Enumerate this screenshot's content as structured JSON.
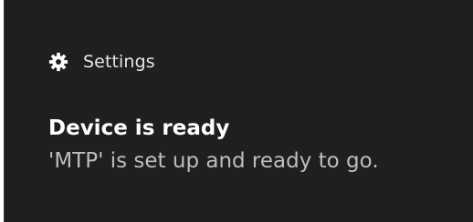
{
  "notification": {
    "app_name": "Settings",
    "app_icon": "gear-icon",
    "title": "Device is ready",
    "body": "'MTP' is set up and ready to go."
  },
  "colors": {
    "background": "#1f1f1f",
    "title": "#ffffff",
    "body": "#bdbdbd"
  }
}
